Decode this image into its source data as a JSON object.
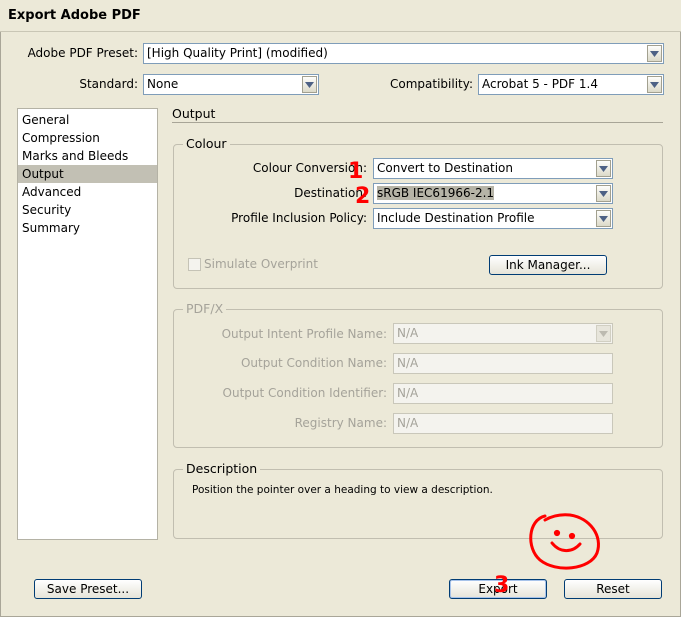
{
  "window": {
    "title": "Export Adobe PDF"
  },
  "preset": {
    "label": "Adobe PDF Preset:",
    "value": "[High Quality Print] (modified)"
  },
  "standard": {
    "label": "Standard:",
    "value": "None"
  },
  "compatibility": {
    "label": "Compatibility:",
    "value": "Acrobat 5 - PDF 1.4"
  },
  "sidebar": {
    "items": [
      {
        "label": "General"
      },
      {
        "label": "Compression"
      },
      {
        "label": "Marks and Bleeds"
      },
      {
        "label": "Output",
        "active": true
      },
      {
        "label": "Advanced"
      },
      {
        "label": "Security"
      },
      {
        "label": "Summary"
      }
    ]
  },
  "main": {
    "heading": "Output",
    "colour": {
      "title": "Colour",
      "conversion_label": "Colour Conversion:",
      "conversion_value": "Convert to Destination",
      "destination_label": "Destination:",
      "destination_value": "sRGB IEC61966-2.1",
      "policy_label": "Profile Inclusion Policy:",
      "policy_value": "Include Destination Profile",
      "simulate_overprint_label": "Simulate Overprint",
      "ink_manager_label": "Ink Manager..."
    },
    "pdfx": {
      "title": "PDF/X",
      "intent_label": "Output Intent Profile Name:",
      "intent_value": "N/A",
      "condition_name_label": "Output Condition Name:",
      "condition_name_value": "N/A",
      "condition_id_label": "Output Condition Identifier:",
      "condition_id_value": "N/A",
      "registry_label": "Registry Name:",
      "registry_value": "N/A"
    },
    "description": {
      "title": "Description",
      "text": "Position the pointer over a heading to view a description."
    }
  },
  "buttons": {
    "save_preset": "Save Preset...",
    "export": "Export",
    "reset": "Reset"
  },
  "annotations": {
    "marker_1": "1",
    "marker_2": "2",
    "marker_3": "3",
    "color": "#ff0000"
  }
}
